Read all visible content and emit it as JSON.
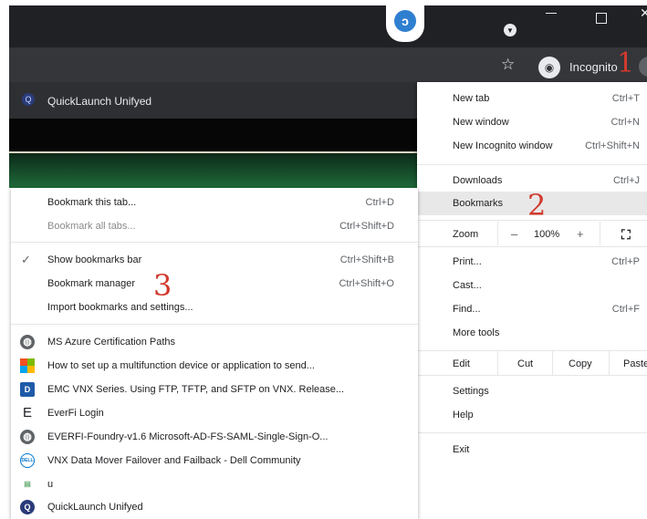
{
  "window": {
    "incognito_label": "Incognito",
    "icons": [
      "extension-logo-icon",
      "tab-search-icon",
      "minimize-icon",
      "maximize-icon",
      "close-icon",
      "bookmark-star-icon",
      "incognito-icon"
    ]
  },
  "bookmarks_bar": {
    "item_label": "QuickLaunch Unifyed"
  },
  "annotations": {
    "one": "1",
    "two": "2",
    "three": "3",
    "color": "#d23a2e"
  },
  "submenu": {
    "bookmark_tab": {
      "label": "Bookmark this tab...",
      "shortcut": "Ctrl+D"
    },
    "bookmark_all": {
      "label": "Bookmark all tabs...",
      "shortcut": "Ctrl+Shift+D"
    },
    "show_bar": {
      "check": "✓",
      "label": "Show bookmarks bar",
      "shortcut": "Ctrl+Shift+B"
    },
    "manager": {
      "label": "Bookmark manager",
      "shortcut": "Ctrl+Shift+O"
    },
    "import": {
      "label": "Import bookmarks and settings..."
    },
    "bookmarks": [
      {
        "icon": "globe-icon",
        "label": "MS Azure Certification Paths"
      },
      {
        "icon": "microsoft-icon",
        "label": "How to set up a multifunction device or application to send..."
      },
      {
        "icon": "document-d-icon",
        "label": "EMC VNX Series. Using FTP, TFTP, and SFTP on VNX. Release..."
      },
      {
        "icon": "everfi-icon",
        "label": "EverFi Login"
      },
      {
        "icon": "globe-icon",
        "label": "EVERFI-Foundry-v1.6 Microsoft-AD-FS-SAML-Single-Sign-O..."
      },
      {
        "icon": "dell-icon",
        "label": "VNX Data Mover Failover and Failback - Dell Community"
      },
      {
        "icon": "u-icon",
        "label": "u"
      },
      {
        "icon": "quicklaunch-icon",
        "label": "QuickLaunch Unifyed"
      }
    ]
  },
  "mainmenu": {
    "new_tab": {
      "label": "New tab",
      "shortcut": "Ctrl+T"
    },
    "new_window": {
      "label": "New window",
      "shortcut": "Ctrl+N"
    },
    "new_incognito": {
      "label": "New Incognito window",
      "shortcut": "Ctrl+Shift+N"
    },
    "downloads": {
      "label": "Downloads",
      "shortcut": "Ctrl+J"
    },
    "bookmarks": {
      "label": "Bookmarks"
    },
    "zoom": {
      "label": "Zoom",
      "minus": "–",
      "value": "100%",
      "plus": "+"
    },
    "print": {
      "label": "Print...",
      "shortcut": "Ctrl+P"
    },
    "cast": {
      "label": "Cast..."
    },
    "find": {
      "label": "Find...",
      "shortcut": "Ctrl+F"
    },
    "more_tools": {
      "label": "More tools"
    },
    "edit": {
      "label": "Edit",
      "cut": "Cut",
      "copy": "Copy",
      "paste": "Paste"
    },
    "settings": {
      "label": "Settings"
    },
    "help": {
      "label": "Help"
    },
    "exit": {
      "label": "Exit"
    }
  }
}
